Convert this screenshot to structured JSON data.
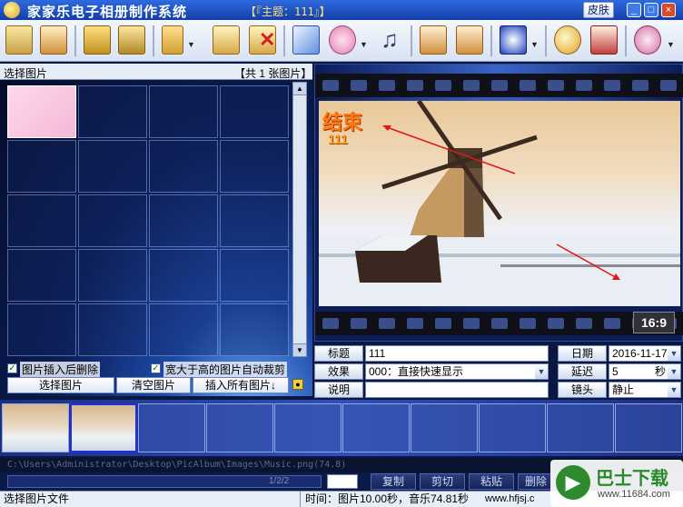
{
  "app": {
    "title": "家家乐电子相册制作系统",
    "theme_label": "【『主题：111』】",
    "skin_button": "皮肤",
    "win_buttons": [
      "_",
      "□",
      "×"
    ]
  },
  "toolbar": {
    "icons": [
      "album-icon",
      "photo-book-icon",
      "save-icon",
      "save-all-icon",
      "frame-icon",
      "picture-open-icon",
      "picture-delete-icon",
      "edit-pen-icon",
      "palette-icon",
      "music-note-icon",
      "import-icon",
      "export-icon",
      "effect-screen-icon",
      "magnifier-icon",
      "film-tools-icon",
      "settings-ball-icon"
    ]
  },
  "left_panel": {
    "header_title": "选择图片",
    "header_count": "【共 1 张图片】",
    "checkbox_delete_after_insert": "图片插入后删除",
    "checkbox_auto_crop": "宽大于高的图片自动裁剪",
    "checkbox_delete_checked": true,
    "checkbox_crop_checked": true,
    "btn_select": "选择图片",
    "btn_clear": "清空图片",
    "btn_insert_all": "插入所有图片↓"
  },
  "preview": {
    "overlay_title": "结束",
    "overlay_subtitle": "111",
    "aspect_badge": "16:9"
  },
  "fields": {
    "title_label": "标题",
    "title_value": "111",
    "effect_label": "效果",
    "effect_value": "000：直接快速显示",
    "desc_label": "说明",
    "desc_value": "",
    "date_label": "日期",
    "date_value": "2016-11-17",
    "delay_label": "延迟",
    "delay_value": "5",
    "delay_unit": "秒",
    "camera_label": "镜头",
    "camera_value": "静止"
  },
  "strip": {
    "thumb_count": 2
  },
  "bottom": {
    "path_text": "C:\\Users\\Administrator\\Desktop\\PicAlbum\\Images\\Music.png(74.8)",
    "counter": "1/2/2",
    "btn_copy": "复制",
    "btn_cut": "剪切",
    "btn_paste": "粘贴",
    "btn_more": "删除"
  },
  "status": {
    "left": "选择图片文件",
    "time": "时间：图片10.00秒，音乐74.81秒",
    "site": "www.hfjsj.c"
  },
  "watermark": {
    "brand": "巴士下载",
    "url": "www.11684.com"
  },
  "colors": {
    "titlebar": "#1f56c8",
    "accent_orange": "#ff7a10",
    "panel_bg": "#0b1d55"
  }
}
